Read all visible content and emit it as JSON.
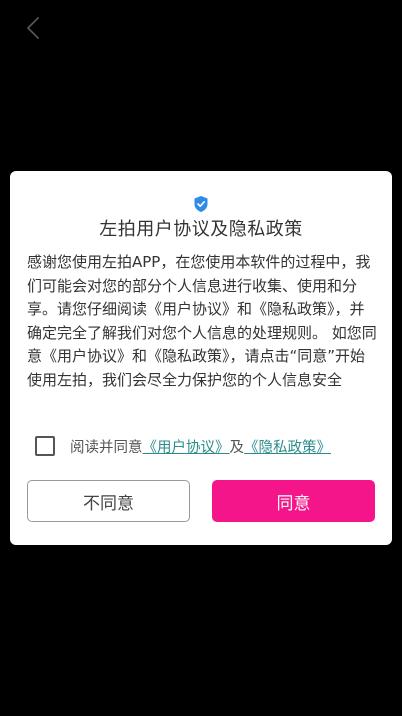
{
  "nav": {
    "back_icon": "chevron-left-icon"
  },
  "dialog": {
    "shield_icon": "shield-check-icon",
    "title": "左拍用户协议及隐私政策",
    "body": "感谢您使用左拍APP，在您使用本软件的过程中，我们可能会对您的部分个人信息进行收集、使用和分享。请您仔细阅读《用户协议》和《隐私政策》，并确定完全了解我们对您个人信息的处理规则。 如您同意《用户协议》和《隐私政策》，请点击“同意”开始使用左拍，我们会尽全力保护您的个人信息安全",
    "agree_prefix": "阅读并同意",
    "link_user_agreement": "《用户协议》",
    "and_text": "及",
    "link_privacy_policy": "《隐私政策》",
    "checkbox_checked": false,
    "disagree_label": "不同意",
    "agree_label": "同意"
  },
  "colors": {
    "background": "#000000",
    "dialog_bg": "#ffffff",
    "accent": "#f4158a",
    "link": "#2a8c8c",
    "shield": "#2f8be6"
  }
}
